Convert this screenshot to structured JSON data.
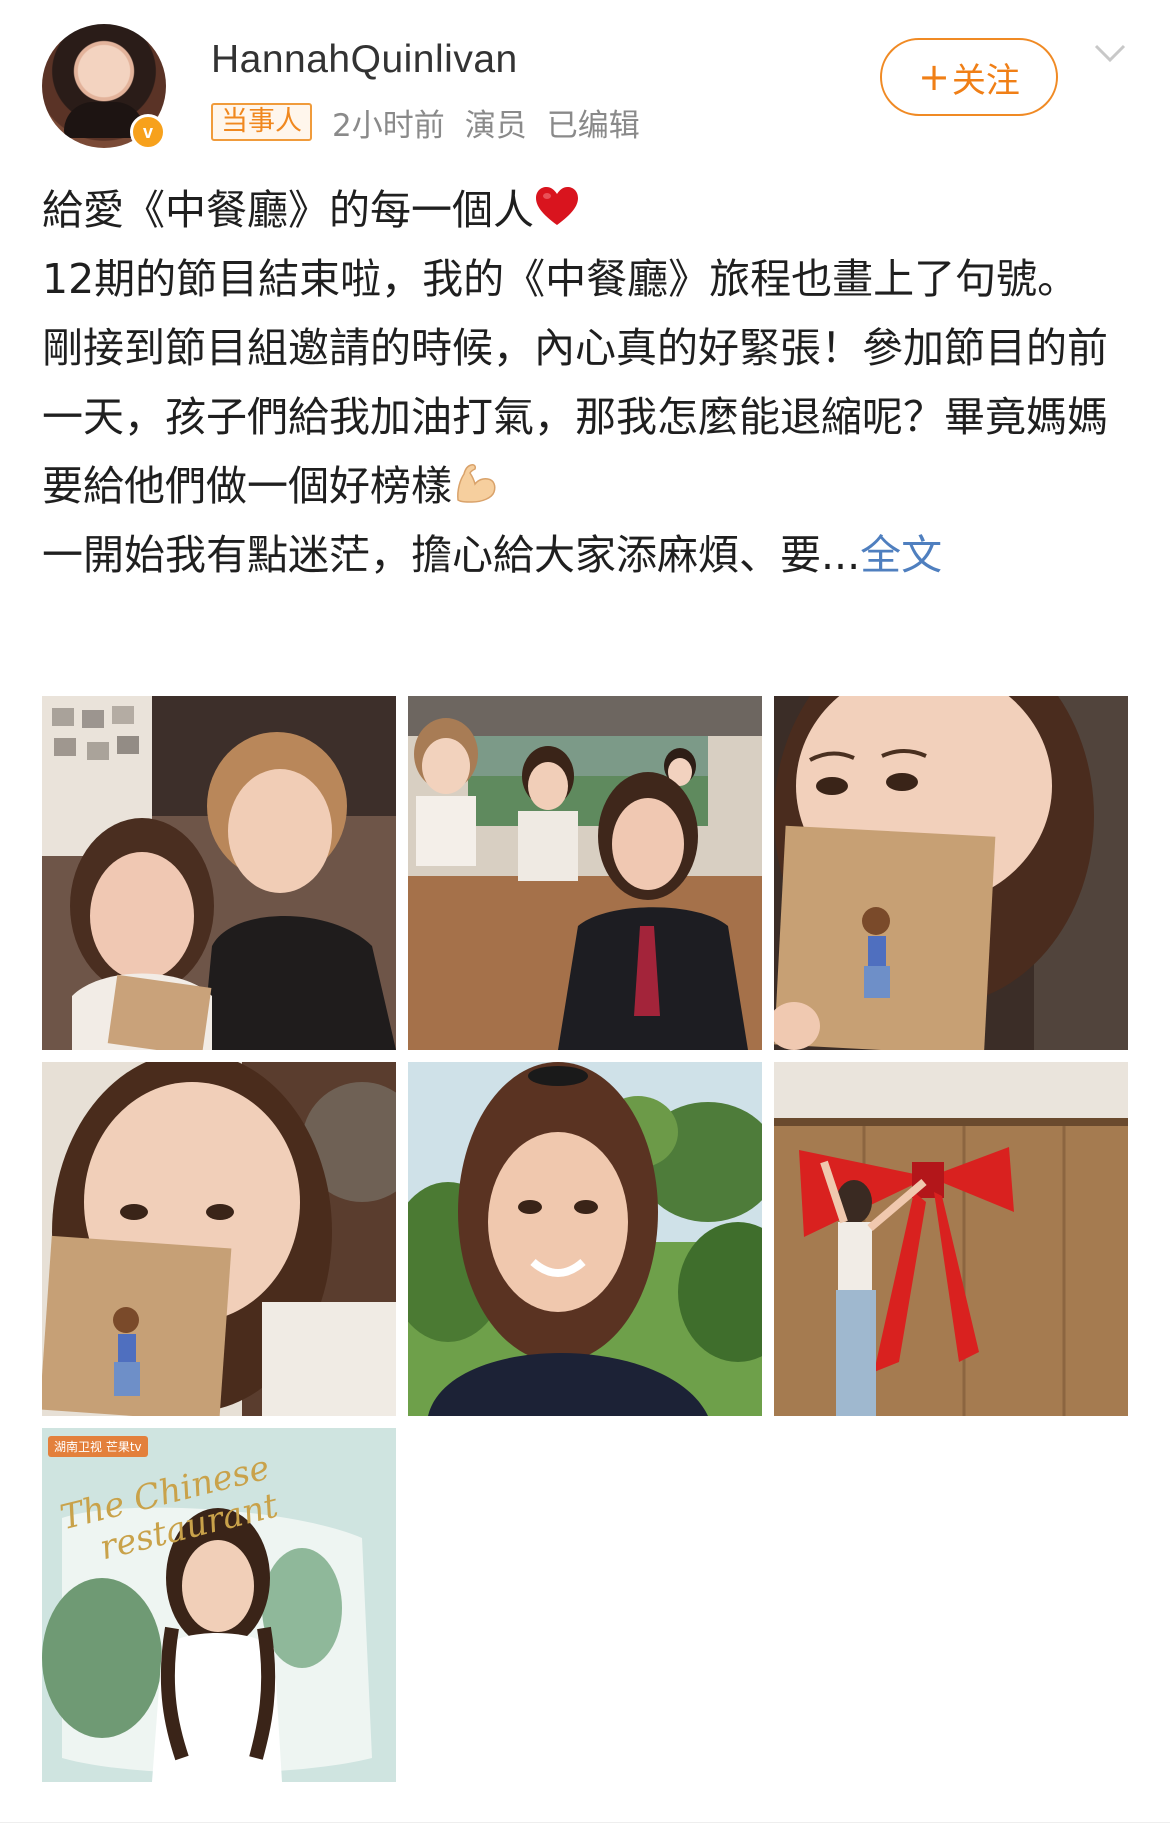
{
  "post": {
    "username": "HannahQuinlivan",
    "tag": "当事人",
    "time": "2小时前",
    "role": "演员",
    "edited": "已编辑",
    "follow_label": "关注",
    "follow_icon": "+",
    "verified_icon": "v",
    "lines": [
      "給愛《中餐廳》的每一個人",
      "12期的節目結束啦，我的《中餐廳》旅程也畫上了句號。",
      "剛接到節目組邀請的時候，內心真的好緊張！參加節目的前一天，孩子們給我加油打氣，那我怎麼能退縮呢？畢竟媽媽要給他們做一個好榜樣",
      "一開始我有點迷茫，擔心給大家添麻煩、要..."
    ],
    "expand_label": "全文",
    "icons": {
      "heart": "heart-icon",
      "muscle": "muscle-icon",
      "chevron": "chevron-down-icon"
    }
  },
  "poster": {
    "title_line1": "The Chinese",
    "title_line2": "restaurant",
    "logos": "湖南卫视 芒果tv"
  },
  "colors": {
    "accent_orange": "#f08a24",
    "link_blue": "#4f7fbf",
    "meta_gray": "#8a8a8a"
  }
}
